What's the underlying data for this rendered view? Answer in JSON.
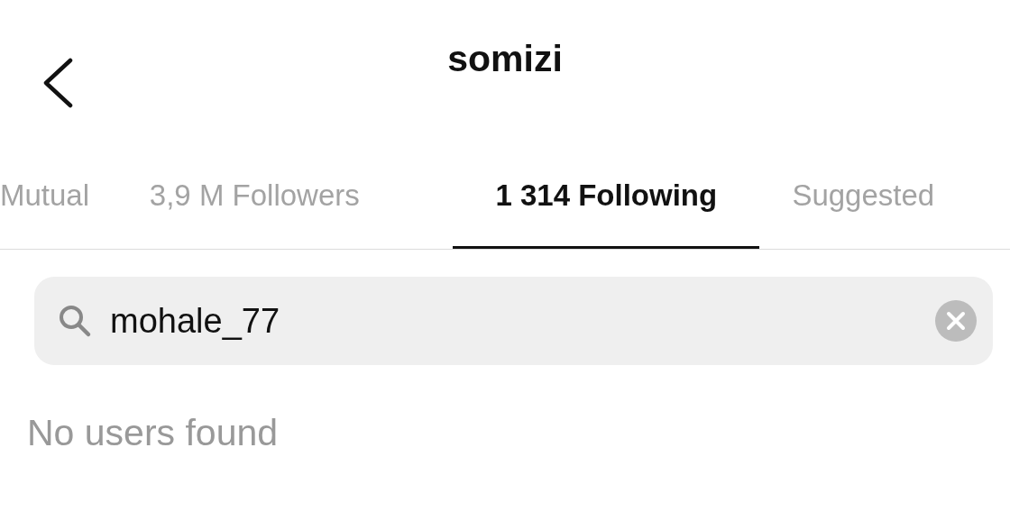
{
  "header": {
    "title": "somizi"
  },
  "tabs": [
    {
      "label": "Mutual",
      "selected": false
    },
    {
      "label": "3,9 M Followers",
      "selected": false
    },
    {
      "label": "1 314 Following",
      "selected": true
    },
    {
      "label": "Suggested",
      "selected": false
    }
  ],
  "search": {
    "value": "mohale_77"
  },
  "empty_message": "No users found"
}
